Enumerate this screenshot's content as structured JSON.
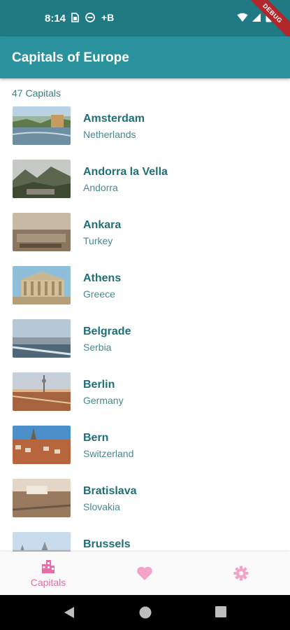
{
  "status_bar": {
    "time": "8:14",
    "extra": "+B",
    "debug": "DEBUG"
  },
  "app_bar": {
    "title": "Capitals of Europe"
  },
  "count_label": "47 Capitals",
  "capitals": [
    {
      "city": "Amsterdam",
      "country": "Netherlands"
    },
    {
      "city": "Andorra la Vella",
      "country": "Andorra"
    },
    {
      "city": "Ankara",
      "country": "Turkey"
    },
    {
      "city": "Athens",
      "country": "Greece"
    },
    {
      "city": "Belgrade",
      "country": "Serbia"
    },
    {
      "city": "Berlin",
      "country": "Germany"
    },
    {
      "city": "Bern",
      "country": "Switzerland"
    },
    {
      "city": "Bratislava",
      "country": "Slovakia"
    },
    {
      "city": "Brussels",
      "country": ""
    }
  ],
  "bottom_nav": {
    "items": [
      {
        "label": "Capitals",
        "icon": "city-icon",
        "active": true
      },
      {
        "label": "",
        "icon": "heart-icon",
        "active": false
      },
      {
        "label": "",
        "icon": "gear-icon",
        "active": false
      }
    ]
  },
  "colors": {
    "status_bar": "#1f7a84",
    "app_bar": "#2a929c",
    "accent_pink": "#e56fa4",
    "title_text": "#1e6f78"
  }
}
